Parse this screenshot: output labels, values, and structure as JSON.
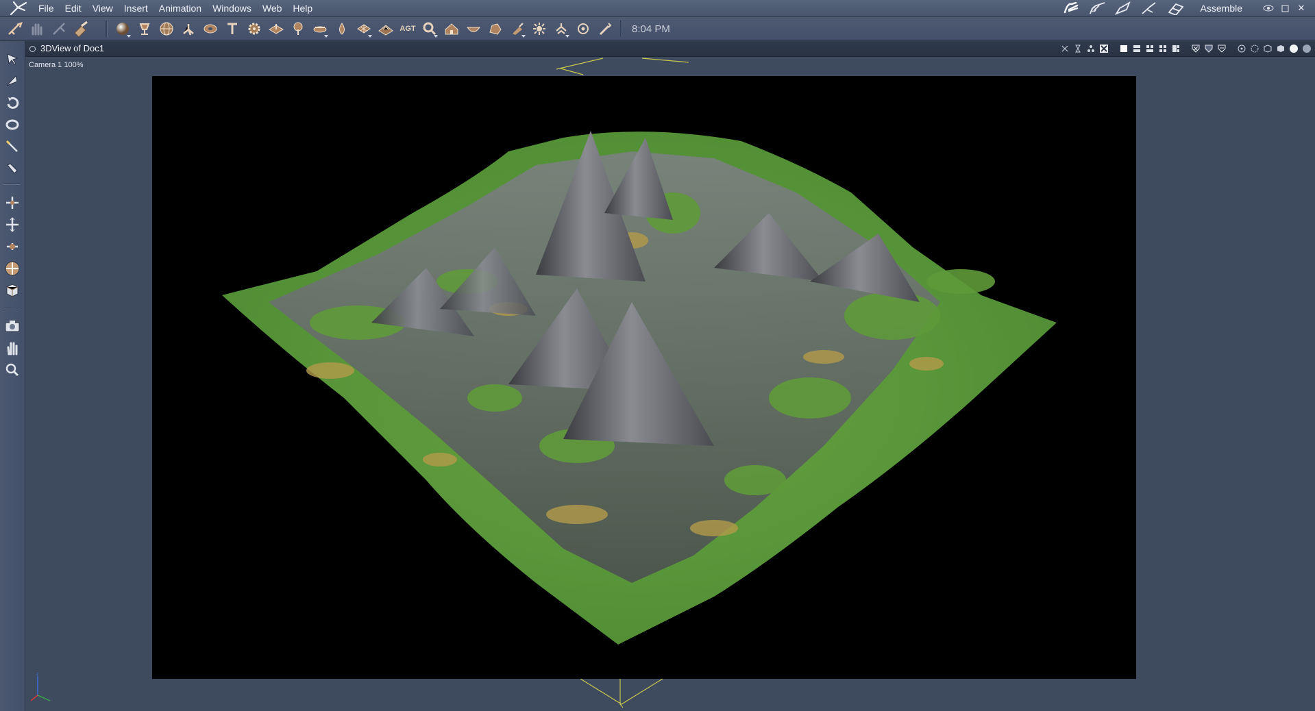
{
  "menubar": {
    "items": [
      {
        "id": "file",
        "label": "File"
      },
      {
        "id": "edit",
        "label": "Edit"
      },
      {
        "id": "view",
        "label": "View"
      },
      {
        "id": "insert",
        "label": "Insert"
      },
      {
        "id": "animation",
        "label": "Animation"
      },
      {
        "id": "windows",
        "label": "Windows"
      },
      {
        "id": "web",
        "label": "Web"
      },
      {
        "id": "help",
        "label": "Help"
      }
    ],
    "room_label": "Assemble",
    "room_icons": [
      "hand-room-icon",
      "shading-room-icon",
      "light-room-icon",
      "render-room-icon",
      "storyboard-room-icon"
    ]
  },
  "toolbar": {
    "clock": "8:04 PM",
    "icons": [
      "select-tool-icon",
      "hand-tool-icon",
      "sphere-primitive-icon",
      "cup-primitive-icon",
      "globe-primitive-icon",
      "tripod-icon",
      "torus-icon",
      "text-icon",
      "gear-icon",
      "plane-icon",
      "tree-icon",
      "disc-icon",
      "drop-icon",
      "box-lattice-icon",
      "terrain-icon",
      "agt-icon",
      "pipe-knot-icon",
      "house-icon",
      "bowl-icon",
      "rock-icon",
      "spotlight-icon",
      "sun-light-icon",
      "bone-icon",
      "target-icon",
      "wand-icon"
    ],
    "agt_label": "AGT"
  },
  "left_tools": [
    "pointer-arrow-icon",
    "rotate-arrow-icon",
    "orbit-icon",
    "twist-icon",
    "magic-wand-icon",
    "paint-brush-icon",
    "move-icon",
    "move-3d-icon",
    "scale-icon",
    "trackball-icon",
    "box-material-icon",
    "camera-icon",
    "pan-hand-icon",
    "zoom-icon"
  ],
  "document": {
    "title": "3DView of Doc1",
    "camera_label": "Camera 1 100%"
  },
  "colors": {
    "grass": "#5f9a3a",
    "rock": "#6a6d72",
    "sand": "#b39a4a",
    "wireframe": "#c8c64a",
    "frame_bg": "#000000",
    "chrome": "#3f4c62"
  }
}
